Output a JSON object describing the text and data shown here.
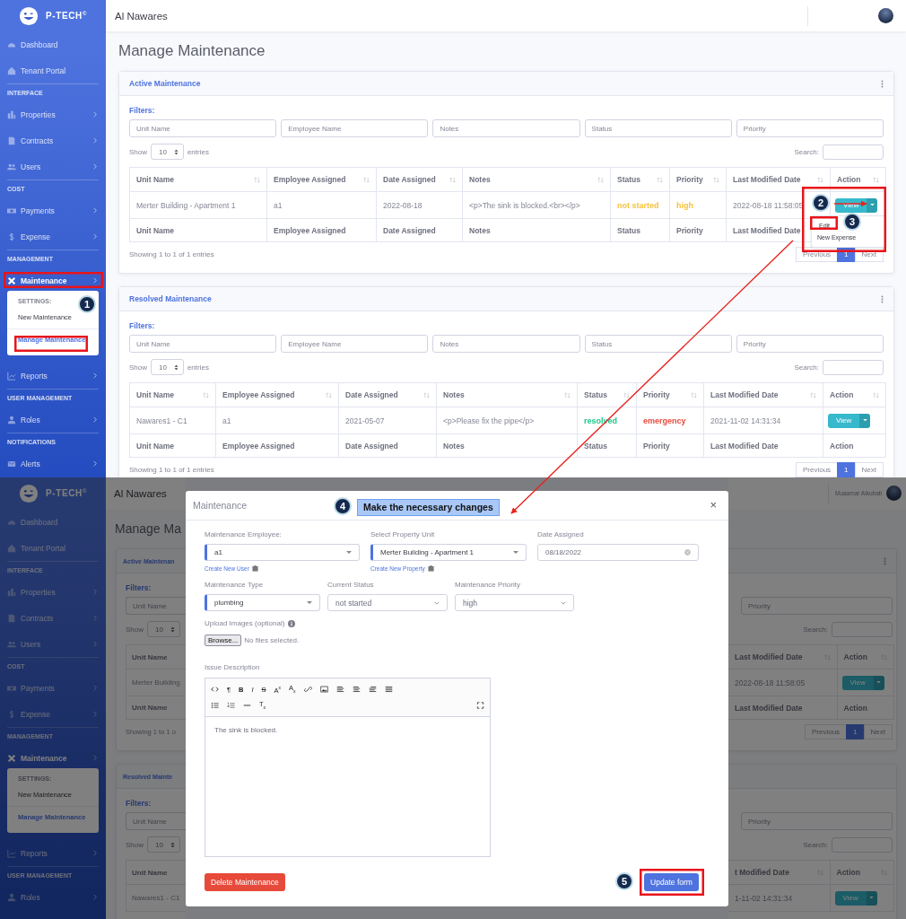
{
  "top_screen": {
    "sidebar": {
      "brand": "P-TECH$^{©}$",
      "groups": [
        {
          "items": [
            {
              "label": "Dashboard",
              "chevron": false,
              "selected": false
            },
            {
              "label": "Tenant Portal",
              "chevron": false,
              "selected": false
            }
          ]
        },
        {
          "heading": "INTERFACE",
          "items": [
            {
              "label": "Properties",
              "chevron": true,
              "selected": false
            },
            {
              "label": "Contracts",
              "chevron": true,
              "selected": false
            },
            {
              "label": "Users",
              "chevron": true,
              "selected": false
            }
          ]
        },
        {
          "heading": "COST",
          "items": [
            {
              "label": "Payments",
              "chevron": true,
              "selected": false
            },
            {
              "label": "Expense",
              "chevron": true,
              "selected": false
            }
          ]
        },
        {
          "heading": "MANAGEMENT",
          "items": [
            {
              "label": "Maintenance",
              "chevron": true,
              "selected": true,
              "submenu": {
                "heading": "SETTINGS:",
                "items": [
                  {
                    "label": "New Maintenance",
                    "selected": false
                  },
                  {
                    "label": "Manage Maintenance",
                    "selected": true
                  }
                ]
              }
            },
            {
              "label": "Reports",
              "chevron": true,
              "selected": false
            }
          ]
        },
        {
          "heading": "USER MANAGEMENT",
          "items": [
            {
              "label": "Roles",
              "chevron": true,
              "selected": false
            }
          ]
        },
        {
          "heading": "NOTIFICATIONS",
          "items": [
            {
              "label": "Alerts",
              "chevron": true,
              "selected": false
            }
          ]
        }
      ]
    },
    "header": {
      "title": "Al Nawares"
    },
    "page_title": "Manage Maintenance",
    "cards": [
      {
        "title": "Active Maintenance",
        "filters_label": "Filters:",
        "filters": [
          {
            "placeholder": "Unit Name"
          },
          {
            "placeholder": "Employee Name"
          },
          {
            "placeholder": "Notes"
          },
          {
            "placeholder": "Status"
          },
          {
            "placeholder": "Priority"
          }
        ],
        "length": {
          "show": "Show",
          "value": "10",
          "entries": "entries"
        },
        "search_label": "Search:",
        "columns": [
          "Unit Name",
          "Employee Assigned",
          "Date Assigned",
          "Notes",
          "Status",
          "Priority",
          "Last Modified Date",
          "Action"
        ],
        "rows": [
          {
            "cells": [
              "Merter Building - Apartment 1",
              "a1",
              "2022-08-18",
              "<p>The sink is blocked.<br></p>"
            ],
            "status": {
              "text": "not started",
              "color": "#f6c23e"
            },
            "priority": {
              "text": "high",
              "color": "#f6c23e"
            },
            "modified": "2022-08-18 11:58:05",
            "action": {
              "label": "View",
              "menu": [
                {
                  "label": "Edit"
                },
                {
                  "label": "New Expense"
                }
              ]
            }
          }
        ],
        "footer_columns": [
          "Unit Name",
          "Employee Assigned",
          "Date Assigned",
          "Notes",
          "Status",
          "Priority",
          "Last Modified Date"
        ],
        "info": "Showing 1 to 1 of 1 entries",
        "pagination": [
          {
            "label": "Previous",
            "selected": false
          },
          {
            "label": "1",
            "selected": true
          },
          {
            "label": "Next",
            "selected": false
          }
        ]
      },
      {
        "title": "Resolved Maintenance",
        "filters_label": "Filters:",
        "filters": [
          {
            "placeholder": "Unit Name"
          },
          {
            "placeholder": "Employee Name"
          },
          {
            "placeholder": "Notes"
          },
          {
            "placeholder": "Status"
          },
          {
            "placeholder": "Priority"
          }
        ],
        "length": {
          "show": "Show",
          "value": "10",
          "entries": "entries"
        },
        "search_label": "Search:",
        "columns": [
          "Unit Name",
          "Employee Assigned",
          "Date Assigned",
          "Notes",
          "Status",
          "Priority",
          "Last Modified Date",
          "Action"
        ],
        "rows": [
          {
            "cells": [
              "Nawares1 - C1",
              "a1",
              "2021-05-07",
              "<p>Please fix the pipe</p>"
            ],
            "status": {
              "text": "resolved",
              "color": "#1cc88a"
            },
            "priority": {
              "text": "emergency",
              "color": "#e74a3b"
            },
            "modified": "2021-11-02 14:31:34",
            "action": {
              "label": "View"
            }
          }
        ],
        "footer_columns": [
          "Unit Name",
          "Employee Assigned",
          "Date Assigned",
          "Notes",
          "Status",
          "Priority",
          "Last Modified Date",
          "Action"
        ],
        "info": "Showing 1 to 1 of 1 entries",
        "pagination": [
          {
            "label": "Previous",
            "selected": false
          },
          {
            "label": "1",
            "selected": true
          },
          {
            "label": "Next",
            "selected": false
          }
        ]
      }
    ]
  },
  "bottom_screen": {
    "sidebar": {
      "brand": "P-TECH$^{©}$",
      "groups": [
        {
          "items": [
            {
              "label": "Dashboard",
              "chevron": false,
              "selected": false
            },
            {
              "label": "Tenant Portal",
              "chevron": false,
              "selected": false
            }
          ]
        },
        {
          "heading": "INTERFACE",
          "items": [
            {
              "label": "Properties",
              "chevron": true,
              "selected": false
            },
            {
              "label": "Contracts",
              "chevron": true,
              "selected": false
            },
            {
              "label": "Users",
              "chevron": true,
              "selected": false
            }
          ]
        },
        {
          "heading": "COST",
          "items": [
            {
              "label": "Payments",
              "chevron": true,
              "selected": false
            },
            {
              "label": "Expense",
              "chevron": true,
              "selected": false
            }
          ]
        },
        {
          "heading": "MANAGEMENT",
          "items": [
            {
              "label": "Maintenance",
              "chevron": true,
              "selected": true,
              "submenu": {
                "heading": "SETTINGS:",
                "items": [
                  {
                    "label": "New Maintenance",
                    "selected": false
                  },
                  {
                    "label": "Manage Maintenance",
                    "selected": true
                  }
                ]
              }
            },
            {
              "label": "Reports",
              "chevron": true,
              "selected": false
            }
          ]
        },
        {
          "heading": "USER MANAGEMENT",
          "items": [
            {
              "label": "Roles",
              "chevron": true,
              "selected": false
            }
          ]
        }
      ]
    },
    "left_strip": {
      "header_title": "Al Nawares",
      "page_title": "Manage Ma",
      "cards": [
        {
          "title": "Active Maintenan",
          "filters_label": "Filters:",
          "placeholder": "Unit Name",
          "show": "Show",
          "length": "10",
          "column": "Unit Name",
          "cell": "Merter Building",
          "footer_column": "Unit Name",
          "info": "Showing 1 to 1 o"
        },
        {
          "title": "Resolved Mainte",
          "filters_label": "Filters:",
          "placeholder": "Unit Name",
          "show": "Show",
          "length": "10",
          "column": "Unit Name",
          "cell": "Nawares1 - C1"
        }
      ]
    },
    "right_strip": {
      "user": "Muaamar Alkubati",
      "cards": [
        {
          "placeholder": "Priority",
          "search_label": "Search:",
          "columns": [
            "Last Modified Date",
            "Action"
          ],
          "row": {
            "modified": "2022-08-18 11:58:05",
            "action": "View"
          },
          "footer_columns": [
            "Last Modified Date",
            "Action"
          ],
          "pagination": [
            {
              "label": "Previous",
              "selected": false
            },
            {
              "label": "1",
              "selected": true
            },
            {
              "label": "Next",
              "selected": false
            }
          ]
        },
        {
          "placeholder": "Priority",
          "search_label": "Search:",
          "columns": [
            "t Modified Date",
            "Action"
          ],
          "row": {
            "modified": "1-11-02 14:31:34",
            "action": "View"
          }
        }
      ]
    },
    "modal": {
      "title": "Maintenance",
      "close": "×",
      "rows": [
        [
          {
            "label": "Maintenance Employee:",
            "value": "a1",
            "kind": "select",
            "required": true,
            "link": "Create New User"
          },
          {
            "label": "Select Property Unit",
            "value": "Merter Building - Apartment 1",
            "kind": "select",
            "required": true,
            "link": "Create New Property"
          },
          {
            "label": "Date Assigned",
            "value": "08/18/2022",
            "kind": "date",
            "required": false
          }
        ],
        [
          {
            "label": "Maintenance Type",
            "value": "plumbing",
            "kind": "select",
            "required": true
          },
          {
            "label": "Current Status",
            "value": "not started",
            "kind": "native",
            "required": false
          },
          {
            "label": "Maintenance Priority",
            "value": "high",
            "kind": "native",
            "required": false
          }
        ]
      ],
      "upload": {
        "label": "Upload Images (optional)",
        "button": "Browse...",
        "status": "No files selected."
      },
      "editor": {
        "label": "Issue Description",
        "glyphs": [
          "¶",
          "B",
          "I",
          "S",
          "A$^{x}$",
          "A$_{x}$",
          "T$_{x}$"
        ],
        "content": "The sink is blocked."
      },
      "buttons": [
        {
          "label": "Delete Maintenance",
          "kind": "danger"
        },
        {
          "label": "Update form",
          "kind": "primary"
        }
      ]
    }
  },
  "annotations": {
    "steps": [
      "1",
      "2",
      "3",
      "4",
      "5"
    ],
    "callout": "Make the necessary changes"
  }
}
